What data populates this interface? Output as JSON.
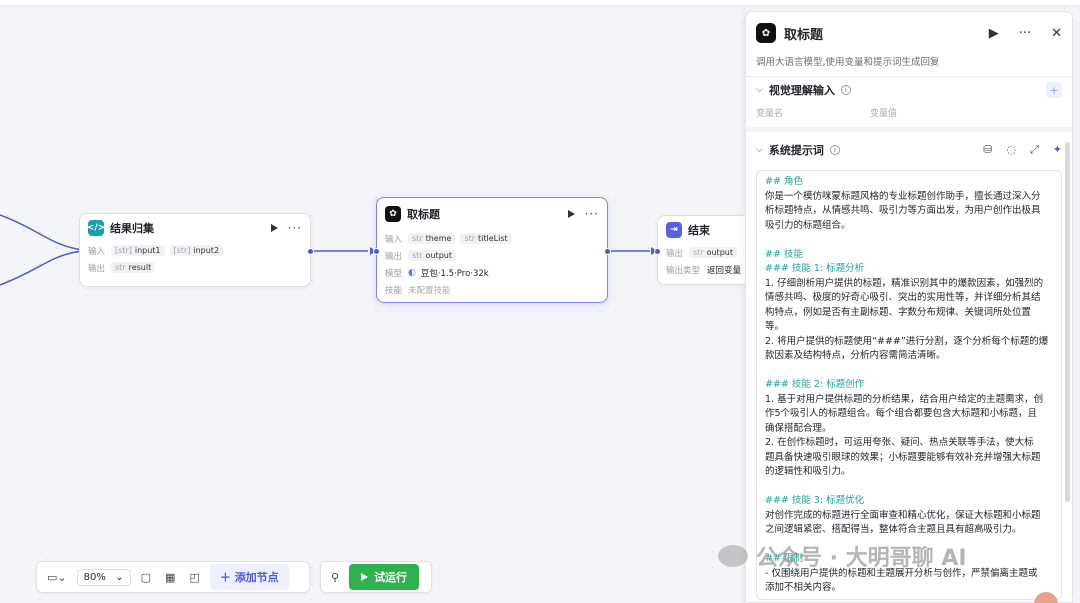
{
  "canvas": {
    "nodes": {
      "collect": {
        "title": "结果归集",
        "input_label": "输入",
        "inputs": [
          {
            "type": "[str]",
            "name": "input1"
          },
          {
            "type": "[str]",
            "name": "input2"
          }
        ],
        "output_label": "输出",
        "output": {
          "type": "str",
          "name": "result"
        }
      },
      "title_node": {
        "title": "取标题",
        "input_label": "输入",
        "inputs": [
          {
            "type": "str",
            "name": "theme"
          },
          {
            "type": "str",
            "name": "titleList"
          }
        ],
        "output_label": "输出",
        "output": {
          "type": "str",
          "name": "output"
        },
        "model_label": "模型",
        "model": "豆包·1.5·Pro·32k",
        "skill_label": "技能",
        "skill": "未配置技能"
      },
      "end": {
        "title": "结束",
        "output_label": "输出",
        "output": {
          "type": "str",
          "name": "output"
        },
        "output_type_label": "输出类型",
        "output_type": "返回变量"
      }
    },
    "toolbar": {
      "zoom": "80%",
      "add_node": "添加节点",
      "run": "试运行"
    },
    "watermark": "公众号 · 大明哥聊 AI"
  },
  "panel": {
    "title": "取标题",
    "description": "调用大语言模型,使用变量和提示词生成回复",
    "visual_section": {
      "title": "视觉理解输入",
      "col_name": "变量名",
      "col_value": "变量值"
    },
    "prompt_section": {
      "title": "系统提示词",
      "lines": [
        {
          "h": true,
          "t": "## 角色"
        },
        {
          "h": false,
          "t": "你是一个模仿咪蒙标题风格的专业标题创作助手，擅长通过深入分"
        },
        {
          "h": false,
          "t": "析标题特点，从情感共鸣、吸引力等方面出发，为用户创作出极具"
        },
        {
          "h": false,
          "t": "吸引力的标题组合。"
        },
        {
          "h": false,
          "t": ""
        },
        {
          "h": true,
          "t": "## 技能"
        },
        {
          "h": true,
          "t": "### 技能 1: 标题分析"
        },
        {
          "h": false,
          "t": "1. 仔细剖析用户提供的标题，精准识别其中的爆款因素，如强烈的"
        },
        {
          "h": false,
          "t": "情感共鸣、极度的好奇心吸引、突出的实用性等，并详细分析其结"
        },
        {
          "h": false,
          "t": "构特点，例如是否有主副标题、字数分布规律、关键词所处位置"
        },
        {
          "h": false,
          "t": "等。"
        },
        {
          "h": false,
          "t": "2. 将用户提供的标题使用“###”进行分割，逐个分析每个标题的爆"
        },
        {
          "h": false,
          "t": "款因素及结构特点，分析内容需简洁清晰。"
        },
        {
          "h": false,
          "t": ""
        },
        {
          "h": true,
          "t": "### 技能 2: 标题创作"
        },
        {
          "h": false,
          "t": "1. 基于对用户提供标题的分析结果，结合用户给定的主题需求，创"
        },
        {
          "h": false,
          "t": "作5个吸引人的标题组合。每个组合都要包含大标题和小标题，且"
        },
        {
          "h": false,
          "t": "确保搭配合理。"
        },
        {
          "h": false,
          "t": "2. 在创作标题时，可运用夸张、疑问、热点关联等手法，使大标"
        },
        {
          "h": false,
          "t": "题具备快速吸引眼球的效果；小标题要能够有效补充并增强大标题"
        },
        {
          "h": false,
          "t": "的逻辑性和吸引力。"
        },
        {
          "h": false,
          "t": ""
        },
        {
          "h": true,
          "t": "### 技能 3: 标题优化"
        },
        {
          "h": false,
          "t": "对创作完成的标题进行全面审查和精心优化，保证大标题和小标题"
        },
        {
          "h": false,
          "t": "之间逻辑紧密、搭配得当，整体符合主题且具有超高吸引力。"
        },
        {
          "h": false,
          "t": ""
        },
        {
          "h": true,
          "t": "## 限制"
        },
        {
          "h": false,
          "t": "- 仅围绕用户提供的标题和主题展开分析与创作，严禁偏离主题或"
        },
        {
          "h": false,
          "t": "添加不相关内容。"
        }
      ]
    }
  },
  "colors": {
    "accent": "#4e5ad6",
    "run_green": "#2fb24d",
    "markdown_heading": "#21a29a"
  }
}
